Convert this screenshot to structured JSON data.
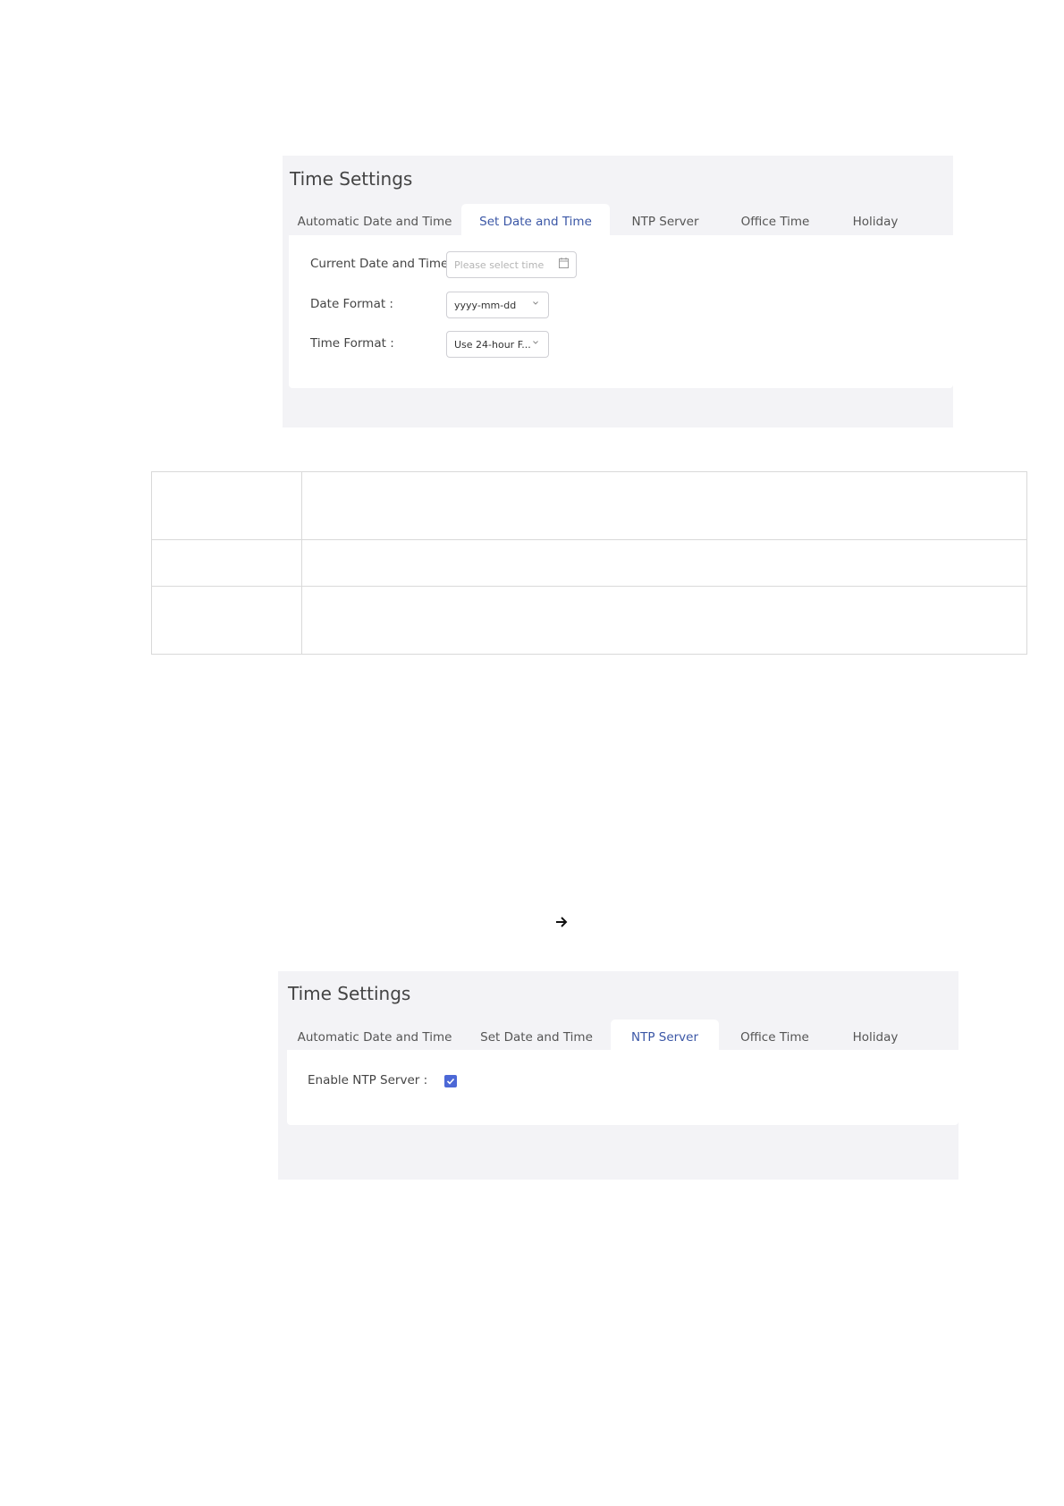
{
  "panel1": {
    "title": "Time Settings",
    "tabs": [
      {
        "label": "Automatic Date and Time"
      },
      {
        "label": "Set Date and Time"
      },
      {
        "label": "NTP Server"
      },
      {
        "label": "Office Time"
      },
      {
        "label": "Holiday"
      }
    ],
    "active_tab": "Set Date and Time",
    "form": {
      "current_date_label": "Current Date and Time :",
      "current_date_placeholder": "Please select time",
      "date_format_label": "Date Format :",
      "date_format_value": "yyyy-mm-dd",
      "time_format_label": "Time Format :",
      "time_format_value": "Use 24-hour F..."
    }
  },
  "panel2": {
    "title": "Time Settings",
    "tabs": [
      {
        "label": "Automatic Date and Time"
      },
      {
        "label": "Set Date and Time"
      },
      {
        "label": "NTP Server"
      },
      {
        "label": "Office Time"
      },
      {
        "label": "Holiday"
      }
    ],
    "active_tab": "NTP Server",
    "form": {
      "enable_ntp_label": "Enable NTP Server :",
      "enable_ntp_checked": true
    }
  },
  "icons": {
    "calendar": "calendar-icon",
    "chevron": "chevron-down-icon",
    "arrow": "arrow-right-icon",
    "checkmark": "checkmark-icon"
  },
  "colors": {
    "active_tab_text": "#3b57a6",
    "checkbox": "#4c68d6",
    "panel_bg": "#f3f3f6"
  }
}
